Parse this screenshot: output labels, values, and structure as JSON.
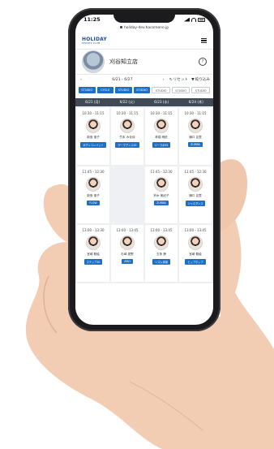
{
  "status_bar": {
    "time": "11:25"
  },
  "browser": {
    "url": "holiday-dev.hacomono.jp"
  },
  "app": {
    "logo_main": "HOLIDAY",
    "logo_sub": "SPORTS CLUB"
  },
  "store": {
    "name": "刈谷知立店",
    "help_label": "?"
  },
  "week": {
    "range": "6/21 - 6/27",
    "prev": "‹",
    "next": "›",
    "reset_label": "リセット",
    "filter_label": "絞り込み"
  },
  "chips": [
    {
      "label": "STUDIO",
      "active": true
    },
    {
      "label": "CYCLE",
      "active": true
    },
    {
      "label": "STUDIO",
      "active": true
    },
    {
      "label": "STUDIO",
      "active": true
    },
    {
      "label": "STUDIO",
      "active": false
    },
    {
      "label": "STUDIO",
      "active": false
    },
    {
      "label": "STUDIO",
      "active": false
    }
  ],
  "days": [
    "6/21 (月)",
    "6/22 (火)",
    "6/23 (水)",
    "6/24 (木)"
  ],
  "rows": [
    [
      {
        "time": "10:30 - 11:15",
        "instructor": "新島 惠子",
        "program": "ボディコンバット"
      },
      {
        "time": "10:30 - 11:15",
        "instructor": "竹本 み化侍",
        "program": "ゲーマデンス45"
      },
      {
        "time": "10:30 - 11:15",
        "instructor": "林橋 明依",
        "program": "ジーラボ45"
      },
      {
        "time": "10:30 - 11:15",
        "instructor": "樋口 友里",
        "program": "ZUMBA"
      }
    ],
    [
      {
        "time": "11:45 - 12:30",
        "instructor": "新島 惠子",
        "program": "FLOW"
      },
      null,
      {
        "time": "11:45 - 12:30",
        "instructor": "鈴木 美紀子",
        "program": "ZUMBA"
      },
      {
        "time": "11:45 - 12:30",
        "instructor": "樋口 友里",
        "program": "ジャズダンス"
      }
    ],
    [
      {
        "time": "13:00 - 13:30",
        "instructor": "宮崎 聡絵",
        "program": "ステップ30"
      },
      {
        "time": "13:00 - 13:45",
        "instructor": "杉崎 夏野",
        "program": "ZIBO"
      },
      {
        "time": "13:00 - 13:45",
        "instructor": "五条 静",
        "program": "リズム体操"
      },
      {
        "time": "13:00 - 13:45",
        "instructor": "宮崎 聡絵",
        "program": "ヒップホップ"
      }
    ]
  ],
  "colors": {
    "accent": "#1f6fc5",
    "header_bg": "#404a56"
  }
}
